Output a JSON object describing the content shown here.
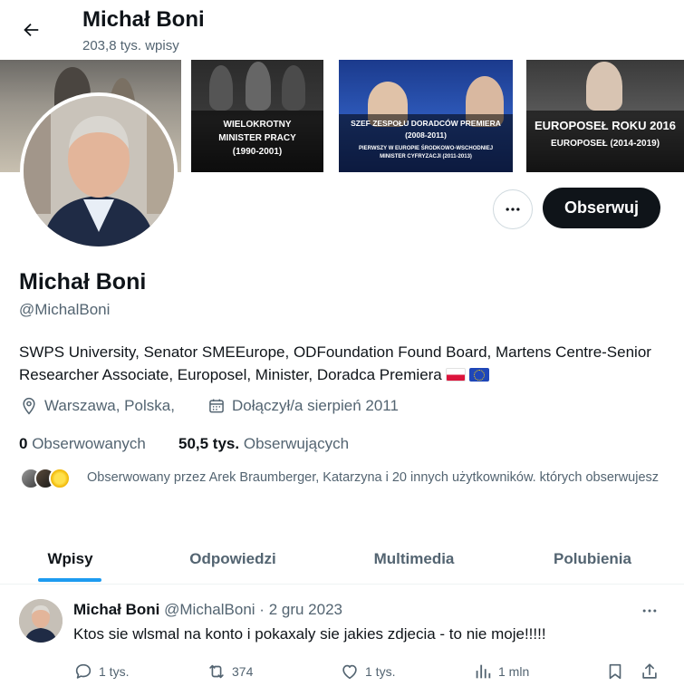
{
  "header": {
    "back_icon": "arrow-left-icon",
    "name": "Michał Boni",
    "post_count": "203,8 tys. wpisy"
  },
  "banner": {
    "panel2_caption": [
      "WIELOKROTNY",
      "MINISTER PRACY",
      "(1990-2001)"
    ],
    "panel3_caption": [
      "SZEF ZESPOŁU DORADCÓW PREMIERA (2008-2011)",
      "PIERWSZY W EUROPIE ŚRODKOWO-WSCHODNIEJ",
      "MINISTER CYFRYZACJI (2011-2013)"
    ],
    "panel4_caption": [
      "EUROPOSEŁ ROKU 2016",
      "EUROPOSEŁ (2014-2019)"
    ]
  },
  "actions": {
    "more_icon": "more-horizontal-icon",
    "follow_label": "Obserwuj"
  },
  "profile": {
    "name": "Michał Boni",
    "handle": "@MichalBoni",
    "bio": "SWPS University, Senator SMEEurope, ODFoundation Found Board, Martens Centre-Senior Researcher Associate, Europosel, Minister, Doradca Premiera",
    "location": "Warszawa, Polska,",
    "joined": "Dołączył/a sierpień 2011",
    "following_count": "0",
    "following_label": "Obserwowanych",
    "followers_count": "50,5 tys.",
    "followers_label": "Obserwujących",
    "followed_by": "Obserwowany przez Arek Braumberger, Katarzyna i 20 innych użytkowników. których obserwujesz"
  },
  "tabs": [
    {
      "label": "Wpisy",
      "active": true
    },
    {
      "label": "Odpowiedzi",
      "active": false
    },
    {
      "label": "Multimedia",
      "active": false
    },
    {
      "label": "Polubienia",
      "active": false
    }
  ],
  "post": {
    "author": "Michał Boni",
    "handle": "@MichalBoni",
    "separator": "·",
    "date": "2 gru 2023",
    "text": "Ktos sie wlsmal na konto i pokaxaly sie jakies zdjecia - to nie moje!!!!!",
    "replies": "1 tys.",
    "reposts": "374",
    "likes": "1 tys.",
    "views": "1 mln"
  },
  "colors": {
    "accent": "#1d9bf0",
    "text": "#0f1419",
    "secondary": "#536471",
    "follow_bg": "#0f1419"
  }
}
